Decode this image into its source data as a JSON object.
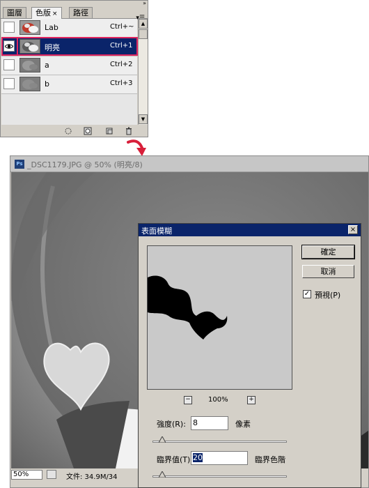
{
  "channels_panel": {
    "tabs": [
      {
        "label": "圖層"
      },
      {
        "label": "色版",
        "close": "×"
      },
      {
        "label": "路徑"
      }
    ],
    "collapse_icon": "double-chevron-icon",
    "menu_icon": "panel-menu-icon",
    "channels": [
      {
        "name": "Lab",
        "shortcut": "Ctrl+~",
        "visible": false,
        "selected": false
      },
      {
        "name": "明亮",
        "shortcut": "Ctrl+1",
        "visible": true,
        "selected": true
      },
      {
        "name": "a",
        "shortcut": "Ctrl+2",
        "visible": false,
        "selected": false
      },
      {
        "name": "b",
        "shortcut": "Ctrl+3",
        "visible": false,
        "selected": false
      }
    ],
    "bottom_icons": [
      "load-selection-icon",
      "save-selection-icon",
      "new-channel-icon",
      "delete-channel-icon"
    ],
    "highlight_color": "#e0245e",
    "selection_color": "#0a246a"
  },
  "document": {
    "title": "_DSC1179.JPG @ 50% (明亮/8)",
    "zoom": "50%",
    "file_info": "文件: 34.9M/34"
  },
  "dialog": {
    "title": "表面模糊",
    "close": "×",
    "ok_label": "確定",
    "cancel_label": "取消",
    "preview_label": "預視(P)",
    "preview_checked": "✓",
    "preview_zoom": "100%",
    "zoom_out": "−",
    "zoom_in": "+",
    "radius_label": "強度(R):",
    "radius_value": "8",
    "radius_unit": "像素",
    "threshold_label": "臨界值(T):",
    "threshold_value": "20",
    "threshold_unit": "臨界色階",
    "title_bar_color": "#0a246a"
  }
}
